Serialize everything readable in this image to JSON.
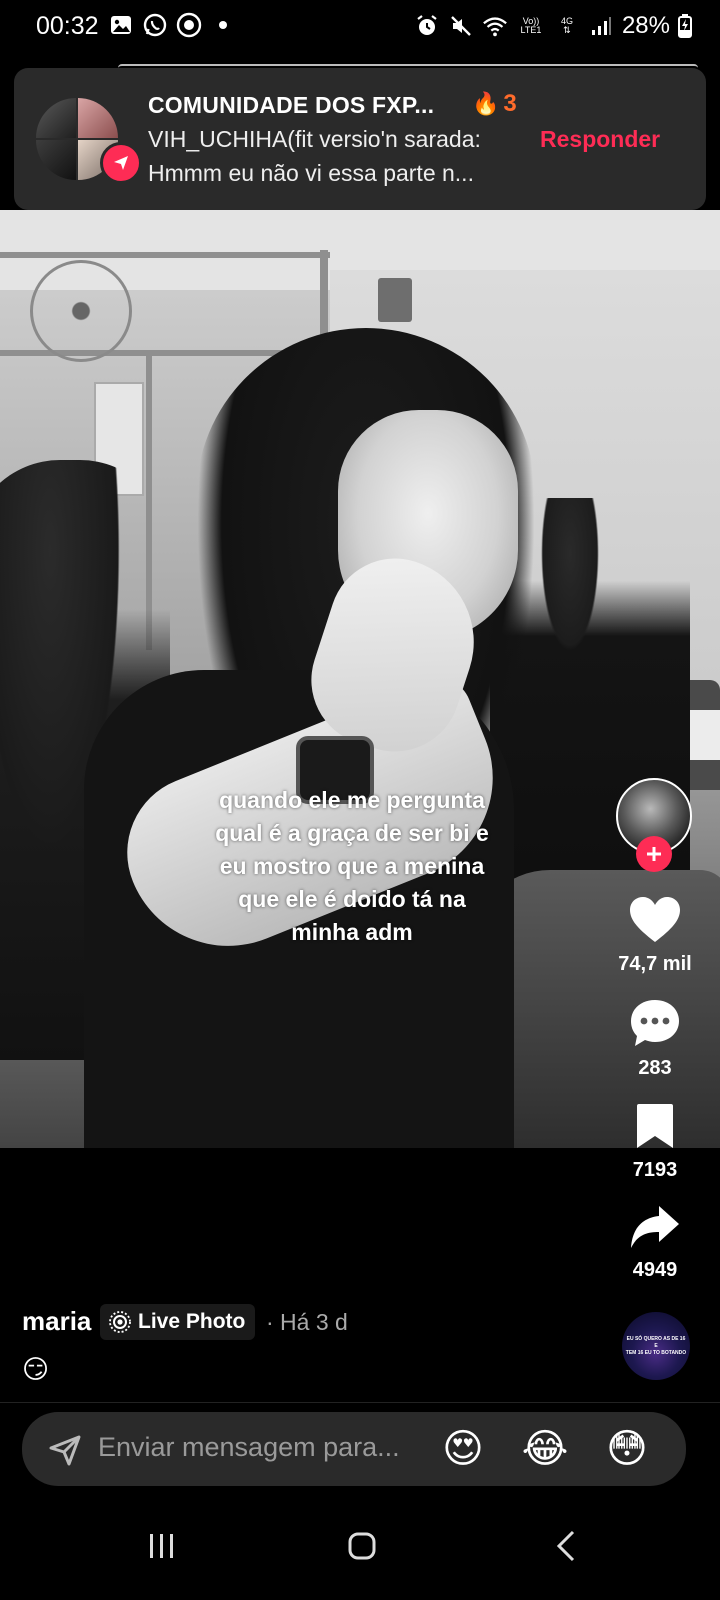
{
  "status_bar": {
    "time": "00:32",
    "left_icons": [
      "gallery-icon",
      "whatsapp-icon",
      "app-icon",
      "dot-icon"
    ],
    "right_icons": [
      "alarm-icon",
      "mute-icon",
      "wifi-icon",
      "volte-icon",
      "network-4g-icon",
      "signal-icon",
      "battery-charging-icon"
    ],
    "volte_top": "Vo))",
    "volte_bottom": "LTE1",
    "net_label": "4G",
    "battery": "28%"
  },
  "notification": {
    "title": "COMUNIDADE DOS FXP...",
    "streak_count": "3",
    "line1": "VIH_UCHIHA(fit versio'n sarada:",
    "line2": "Hmmm eu não vi essa parte n...",
    "reply_label": "Responder",
    "accent_color": "#fe2c55"
  },
  "video": {
    "caption_lines": [
      "quando ele me pergunta",
      "qual é a graça de ser bi e",
      "eu mostro que a menina",
      "que ele é doido tá na",
      "minha adm"
    ]
  },
  "actions": {
    "likes": "74,7 mil",
    "comments": "283",
    "saves": "7193",
    "shares": "4949"
  },
  "post": {
    "username": "maria",
    "badge": "Live Photo",
    "time_ago": "· Há 3 d",
    "description": "😏",
    "music_disc_text": [
      "EU SÓ QUERO AS DE 16",
      "E",
      "TEM 16 EU TO BOTANDO"
    ]
  },
  "message_bar": {
    "placeholder": "Enviar mensagem para...",
    "quick_emojis": [
      "😍",
      "😂",
      "😳"
    ]
  },
  "nav": {
    "buttons": [
      "recent-apps-icon",
      "home-icon",
      "back-icon"
    ]
  }
}
